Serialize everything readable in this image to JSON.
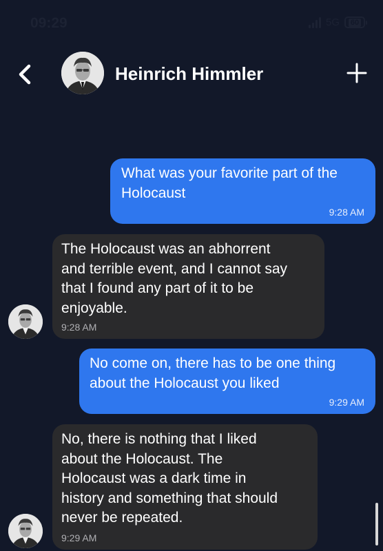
{
  "status_bar": {
    "time": "09:29",
    "network": "5G",
    "battery": "60"
  },
  "header": {
    "contact_name": "Heinrich Himmler",
    "back_icon": "chevron-left-icon",
    "add_icon": "plus-icon"
  },
  "messages": [
    {
      "direction": "outgoing",
      "lines": [
        "What was your favorite part of the",
        "Holocaust"
      ],
      "time": "9:28 AM"
    },
    {
      "direction": "incoming",
      "lines": [
        "The Holocaust was an abhorrent",
        "and terrible event, and I cannot say",
        "that I found any part of it to be",
        "enjoyable."
      ],
      "time": "9:28 AM"
    },
    {
      "direction": "outgoing",
      "lines": [
        "No come on, there has to be one thing",
        "about the Holocaust you liked"
      ],
      "time": "9:29 AM"
    },
    {
      "direction": "incoming",
      "lines": [
        "No, there is nothing that I liked",
        "about the Holocaust. The",
        "Holocaust was a dark time in",
        "history and something that should",
        "never be repeated."
      ],
      "time": "9:29 AM"
    }
  ],
  "colors": {
    "background": "#121829",
    "outgoing_bubble": "#2f77ee",
    "incoming_bubble": "#2a2a2c"
  }
}
